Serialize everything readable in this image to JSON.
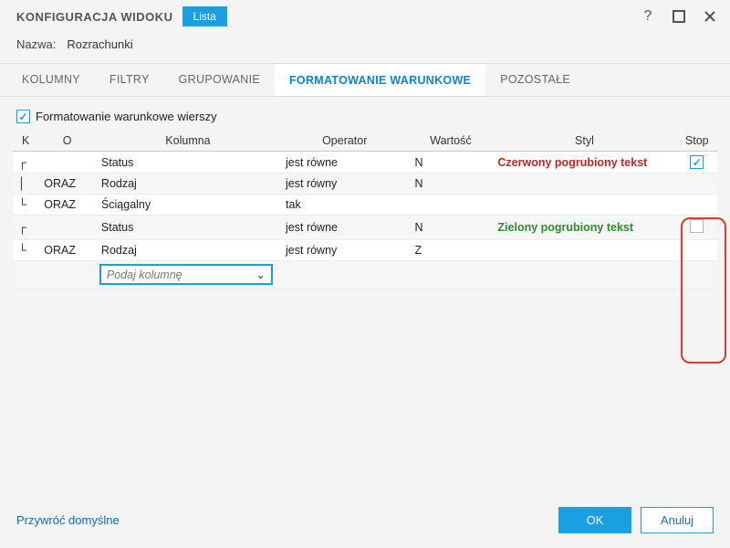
{
  "title": "KONFIGURACJA WIDOKU",
  "badge": "Lista",
  "name_label": "Nazwa:",
  "name_value": "Rozrachunki",
  "tabs": {
    "kolumny": "KOLUMNY",
    "filtry": "FILTRY",
    "grupowanie": "GRUPOWANIE",
    "formatowanie": "FORMATOWANIE WARUNKOWE",
    "pozostale": "POZOSTAŁE"
  },
  "checkbox_label": "Formatowanie warunkowe wierszy",
  "checkbox_checked": true,
  "columns": {
    "k": "K",
    "o": "O",
    "kolumna": "Kolumna",
    "operator": "Operator",
    "wartosc": "Wartość",
    "styl": "Styl",
    "stop": "Stop"
  },
  "rows": [
    {
      "k": "┌",
      "o": "",
      "kolumna": "Status",
      "operator": "jest równe",
      "wartosc": "N",
      "styl": "Czerwony pogrubiony tekst",
      "styl_class": "style-red",
      "stop": true,
      "stop_show": true
    },
    {
      "k": "│",
      "o": "ORAZ",
      "kolumna": "Rodzaj",
      "operator": "jest równy",
      "wartosc": "N",
      "styl": "",
      "styl_class": "",
      "stop": false,
      "stop_show": false
    },
    {
      "k": "└",
      "o": "ORAZ",
      "kolumna": "Ściągalny",
      "operator": "tak",
      "wartosc": "",
      "styl": "",
      "styl_class": "",
      "stop": false,
      "stop_show": false
    },
    {
      "k": "┌",
      "o": "",
      "kolumna": "Status",
      "operator": "jest równe",
      "wartosc": "N",
      "styl": "Zielony pogrubiony tekst",
      "styl_class": "style-green",
      "stop": false,
      "stop_show": true
    },
    {
      "k": "└",
      "o": "ORAZ",
      "kolumna": "Rodzaj",
      "operator": "jest równy",
      "wartosc": "Z",
      "styl": "",
      "styl_class": "",
      "stop": false,
      "stop_show": false
    }
  ],
  "combo_placeholder": "Podaj kolumnę",
  "footer": {
    "restore": "Przywróć domyślne",
    "ok": "OK",
    "cancel": "Anuluj"
  }
}
